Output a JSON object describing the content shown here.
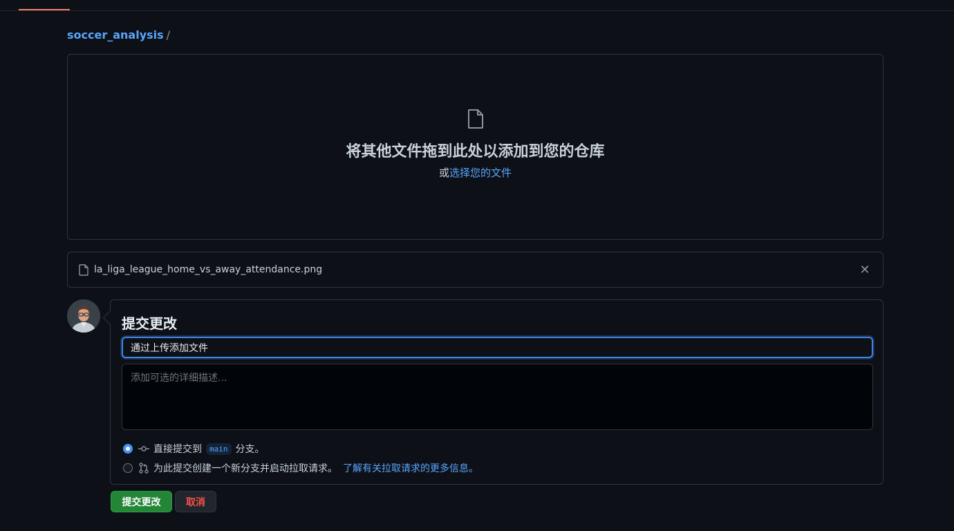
{
  "breadcrumb": {
    "repo": "soccer_analysis",
    "separator": "/"
  },
  "dropzone": {
    "icon": "file-icon",
    "title": "将其他文件拖到此处以添加到您的仓库",
    "or_text": "或",
    "choose_link": "选择您的文件"
  },
  "file": {
    "name": "la_liga_league_home_vs_away_attendance.png",
    "icon": "file-icon",
    "remove_icon": "close-icon",
    "remove_glyph": "✕"
  },
  "commit": {
    "title": "提交更改",
    "message_value": "通过上传添加文件",
    "description_placeholder": "添加可选的详细描述...",
    "option_direct_pre": "直接提交到",
    "branch": "main",
    "option_direct_post": "分支。",
    "option_pr": "为此提交创建一个新分支并启动拉取请求。",
    "option_pr_link": "了解有关拉取请求的更多信息。",
    "selected_option": "direct"
  },
  "buttons": {
    "commit": "提交更改",
    "cancel": "取消"
  },
  "colors": {
    "accent": "#58a6ff",
    "primary_button": "#238636",
    "danger": "#f85149",
    "tab_underline": "#f78166"
  }
}
